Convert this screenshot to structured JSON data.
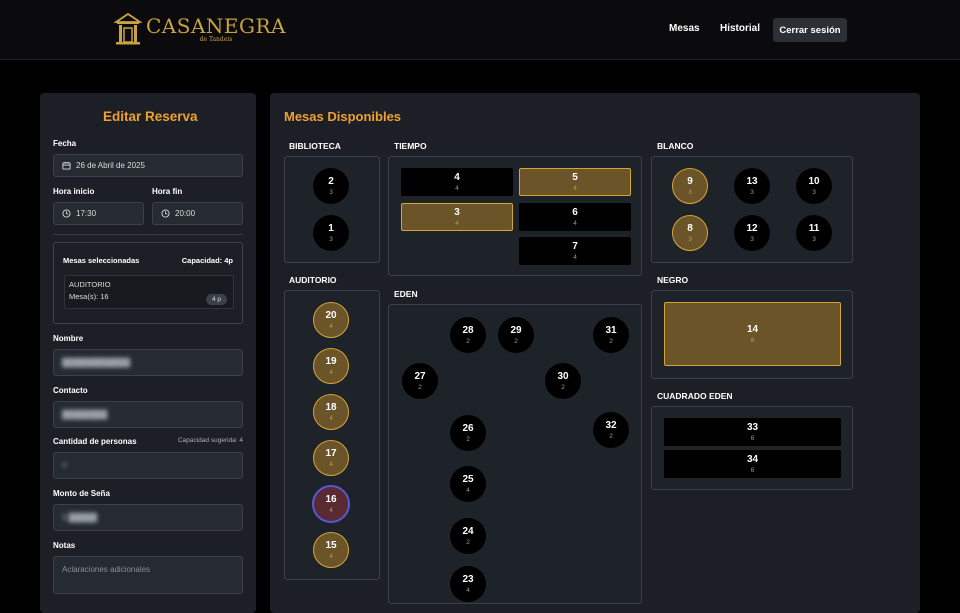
{
  "header": {
    "logo_name": "CASANEGRA",
    "logo_sub": "de Tandeis",
    "nav": [
      "Mesas",
      "Historial"
    ],
    "logout": "Cerrar sesión"
  },
  "form": {
    "title": "Editar Reserva",
    "fecha_label": "Fecha",
    "fecha_value": "26 de Abril de 2025",
    "hora_inicio_label": "Hora inicio",
    "hora_inicio_value": "17:30",
    "hora_fin_label": "Hora fin",
    "hora_fin_value": "20:00",
    "mesas_label": "Mesas seleccionadas",
    "capacidad_label": "Capacidad: 4p",
    "sel_zone": "AUDITORIO",
    "sel_mesas": "Mesa(s): 16",
    "sel_badge": "4 p",
    "nombre_label": "Nombre",
    "nombre_value": "████████████",
    "contacto_label": "Contacto",
    "contacto_value": "████████",
    "cantidad_label": "Cantidad de personas",
    "cantidad_hint": "Capacidad sugerida: 4",
    "cantidad_value": "4",
    "sena_label": "Monto de Seña",
    "sena_value": "$ █████",
    "notas_label": "Notas",
    "notas_placeholder": "Aclaraciones adicionales"
  },
  "tables_panel": {
    "title": "Mesas Disponibles",
    "zones": {
      "biblioteca": "BIBLIOTECA",
      "tiempo": "TIEMPO",
      "blanco": "BLANCO",
      "auditorio": "AUDITORIO",
      "eden": "EDEN",
      "negro": "NEGRO",
      "cuadrado_eden": "CUADRADO EDEN"
    },
    "tables": [
      {
        "id": "b2",
        "num": "2",
        "cap": "3"
      },
      {
        "id": "b1",
        "num": "1",
        "cap": "3"
      },
      {
        "id": "t4",
        "num": "4",
        "cap": "4"
      },
      {
        "id": "t5",
        "num": "5",
        "cap": "4"
      },
      {
        "id": "t3",
        "num": "3",
        "cap": "4"
      },
      {
        "id": "t6",
        "num": "6",
        "cap": "4"
      },
      {
        "id": "t7",
        "num": "7",
        "cap": "4"
      },
      {
        "id": "w9",
        "num": "9",
        "cap": "3"
      },
      {
        "id": "w13",
        "num": "13",
        "cap": "3"
      },
      {
        "id": "w10",
        "num": "10",
        "cap": "3"
      },
      {
        "id": "w8",
        "num": "8",
        "cap": "3"
      },
      {
        "id": "w12",
        "num": "12",
        "cap": "3"
      },
      {
        "id": "w11",
        "num": "11",
        "cap": "3"
      },
      {
        "id": "a20",
        "num": "20",
        "cap": "4"
      },
      {
        "id": "a19",
        "num": "19",
        "cap": "4"
      },
      {
        "id": "a18",
        "num": "18",
        "cap": "4"
      },
      {
        "id": "a17",
        "num": "17",
        "cap": "4"
      },
      {
        "id": "a16",
        "num": "16",
        "cap": "4"
      },
      {
        "id": "a15",
        "num": "15",
        "cap": "4"
      },
      {
        "id": "e28",
        "num": "28",
        "cap": "2"
      },
      {
        "id": "e29",
        "num": "29",
        "cap": "2"
      },
      {
        "id": "e31",
        "num": "31",
        "cap": "2"
      },
      {
        "id": "e27",
        "num": "27",
        "cap": "2"
      },
      {
        "id": "e30",
        "num": "30",
        "cap": "2"
      },
      {
        "id": "e26",
        "num": "26",
        "cap": "2"
      },
      {
        "id": "e32",
        "num": "32",
        "cap": "2"
      },
      {
        "id": "e25",
        "num": "25",
        "cap": "4"
      },
      {
        "id": "e24",
        "num": "24",
        "cap": "2"
      },
      {
        "id": "e23",
        "num": "23",
        "cap": "4"
      },
      {
        "id": "n14",
        "num": "14",
        "cap": "8"
      },
      {
        "id": "c33",
        "num": "33",
        "cap": "6"
      },
      {
        "id": "c34",
        "num": "34",
        "cap": "6"
      }
    ]
  },
  "colors": {
    "accent": "#f0a030",
    "selected_fill": "#6b5428",
    "selected_border": "#d4a43a",
    "current_border": "#5a56d8"
  }
}
